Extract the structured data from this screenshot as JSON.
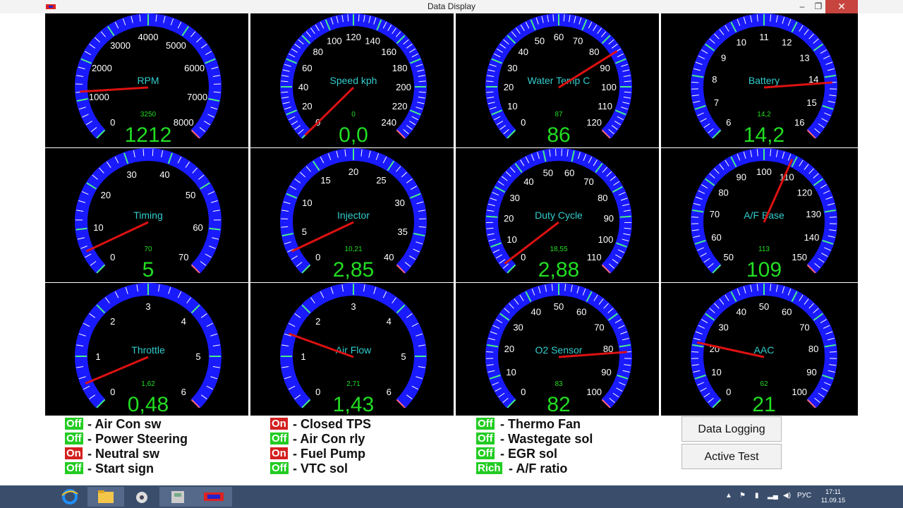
{
  "window": {
    "title": "Data Display",
    "minimize": "–",
    "maximize": "❐",
    "close": "✕"
  },
  "gauges": [
    {
      "label": "RPM",
      "min": 0,
      "max": 8000,
      "ticks": [
        "0",
        "1000",
        "2000",
        "3000",
        "4000",
        "5000",
        "6000",
        "7000",
        "8000"
      ],
      "value": 1212,
      "display": "1212",
      "small": "3250"
    },
    {
      "label": "Speed kph",
      "min": 0,
      "max": 240,
      "ticks": [
        "0",
        "20",
        "40",
        "60",
        "80",
        "100",
        "120",
        "140",
        "160",
        "180",
        "200",
        "220",
        "240"
      ],
      "value": 0,
      "display": "0,0",
      "small": "0"
    },
    {
      "label": "Water Temp C",
      "min": 0,
      "max": 120,
      "ticks": [
        "0",
        "10",
        "20",
        "30",
        "40",
        "50",
        "60",
        "70",
        "80",
        "90",
        "100",
        "110",
        "120"
      ],
      "value": 86,
      "display": "86",
      "small": "87"
    },
    {
      "label": "Battery",
      "min": 6,
      "max": 16,
      "ticks": [
        "6",
        "7",
        "8",
        "9",
        "10",
        "11",
        "12",
        "13",
        "14",
        "15",
        "16"
      ],
      "value": 14.2,
      "display": "14,2",
      "small": "14,2"
    },
    {
      "label": "Timing",
      "min": 0,
      "max": 70,
      "ticks": [
        "0",
        "10",
        "20",
        "30",
        "40",
        "50",
        "60",
        "70"
      ],
      "value": 5,
      "display": "5",
      "small": "70"
    },
    {
      "label": "Injector",
      "min": 0,
      "max": 40,
      "ticks": [
        "0",
        "5",
        "10",
        "15",
        "20",
        "25",
        "30",
        "35",
        "40"
      ],
      "value": 2.85,
      "display": "2,85",
      "small": "10,21"
    },
    {
      "label": "Duty Cycle",
      "min": 0,
      "max": 110,
      "ticks": [
        "0",
        "10",
        "20",
        "30",
        "40",
        "50",
        "60",
        "70",
        "80",
        "90",
        "100",
        "110"
      ],
      "value": 2.88,
      "display": "2,88",
      "small": "18,55"
    },
    {
      "label": "A/F Base",
      "min": 50,
      "max": 150,
      "ticks": [
        "50",
        "60",
        "70",
        "80",
        "90",
        "100",
        "110",
        "120",
        "130",
        "140",
        "150"
      ],
      "value": 109,
      "display": "109",
      "small": "113"
    },
    {
      "label": "Throttle",
      "min": 0,
      "max": 6,
      "ticks": [
        "0",
        "1",
        "2",
        "3",
        "4",
        "5",
        "6"
      ],
      "value": 0.48,
      "display": "0,48",
      "small": "1,62"
    },
    {
      "label": "Air Flow",
      "min": 0,
      "max": 6,
      "ticks": [
        "0",
        "1",
        "2",
        "3",
        "4",
        "5",
        "6"
      ],
      "value": 1.43,
      "display": "1,43",
      "small": "2,71"
    },
    {
      "label": "O2 Sensor",
      "min": 0,
      "max": 100,
      "ticks": [
        "0",
        "10",
        "20",
        "30",
        "40",
        "50",
        "60",
        "70",
        "80",
        "90",
        "100"
      ],
      "value": 82,
      "display": "82",
      "small": "83"
    },
    {
      "label": "AAC",
      "min": 0,
      "max": 100,
      "ticks": [
        "0",
        "10",
        "20",
        "30",
        "40",
        "50",
        "60",
        "70",
        "80",
        "90",
        "100"
      ],
      "value": 21,
      "display": "21",
      "small": "62"
    }
  ],
  "status": {
    "col1": [
      {
        "state": "Off",
        "label": "- Air Con sw"
      },
      {
        "state": "Off",
        "label": "- Power Steering"
      },
      {
        "state": "On",
        "label": "- Neutral sw"
      },
      {
        "state": "Off",
        "label": "- Start sign"
      }
    ],
    "col2": [
      {
        "state": "On",
        "label": "- Closed TPS"
      },
      {
        "state": "Off",
        "label": "- Air Con rly"
      },
      {
        "state": "On",
        "label": "- Fuel Pump"
      },
      {
        "state": "Off",
        "label": "- VTC sol"
      }
    ],
    "col3": [
      {
        "state": "Off",
        "label": "- Thermo Fan"
      },
      {
        "state": "Off",
        "label": "- Wastegate sol"
      },
      {
        "state": "Off",
        "label": "- EGR sol"
      },
      {
        "state": "Rich",
        "label": "- A/F ratio"
      }
    ]
  },
  "buttons": {
    "data_logging": "Data Logging",
    "active_test": "Active Test"
  },
  "taskbar": {
    "tray_lang": "РУС",
    "time": "17:11",
    "date": "11.09.15",
    "apps": [
      "ie-icon",
      "file-explorer-icon",
      "media-icon",
      "installer-icon",
      "nds-app-icon"
    ]
  },
  "colors": {
    "gauge_arc": "#1a1aff",
    "needle": "#dd1111",
    "value": "#22dd22",
    "label": "#33cccc",
    "tick_label": "#ffffff"
  }
}
